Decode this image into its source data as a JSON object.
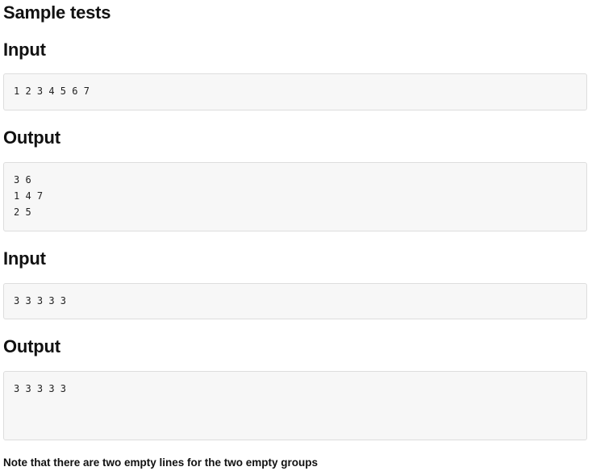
{
  "title": "Sample tests",
  "tests": [
    {
      "input_label": "Input",
      "input": "1 2 3 4 5 6 7",
      "output_label": "Output",
      "output": "3 6\n1 4 7\n2 5"
    },
    {
      "input_label": "Input",
      "input": "3 3 3 3 3",
      "output_label": "Output",
      "output": "3 3 3 3 3\n\n"
    }
  ],
  "note": "Note that there are two empty lines for the two empty groups"
}
